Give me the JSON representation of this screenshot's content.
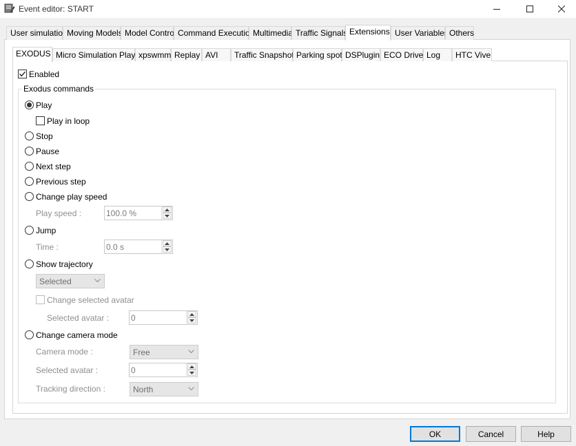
{
  "window": {
    "title": "Event editor: START",
    "app_icon": "editor-icon",
    "controls": [
      "minimize-icon",
      "maximize-icon",
      "close-icon"
    ]
  },
  "main_tabs": [
    {
      "label": "User simulation"
    },
    {
      "label": "Moving Models"
    },
    {
      "label": "Model Control"
    },
    {
      "label": "Command Execution"
    },
    {
      "label": "Multimedia"
    },
    {
      "label": "Traffic Signals"
    },
    {
      "label": "Extensions",
      "active": true
    },
    {
      "label": "User Variables"
    },
    {
      "label": "Others"
    }
  ],
  "sub_tabs": [
    {
      "label": "EXODUS",
      "active": true
    },
    {
      "label": "Micro Simulation Player"
    },
    {
      "label": "xpswmm"
    },
    {
      "label": "Replay"
    },
    {
      "label": "AVI"
    },
    {
      "label": "Traffic Snapshot"
    },
    {
      "label": "Parking spot"
    },
    {
      "label": "DSPlugin"
    },
    {
      "label": "ECO Drive"
    },
    {
      "label": "Log"
    },
    {
      "label": "HTC Vive"
    }
  ],
  "enabled": {
    "label": "Enabled",
    "checked": true
  },
  "group": {
    "title": "Exodus commands"
  },
  "commands": {
    "play": {
      "label": "Play",
      "selected": true
    },
    "play_in_loop": {
      "label": "Play in loop",
      "checked": false
    },
    "stop": {
      "label": "Stop"
    },
    "pause": {
      "label": "Pause"
    },
    "next_step": {
      "label": "Next step"
    },
    "previous_step": {
      "label": "Previous step"
    },
    "change_play_speed": {
      "label": "Change play speed"
    },
    "play_speed": {
      "label": "Play speed :",
      "value": "100.0 %"
    },
    "jump": {
      "label": "Jump"
    },
    "time": {
      "label": "Time :",
      "value": "0.0 s"
    },
    "show_trajectory": {
      "label": "Show trajectory"
    },
    "trajectory_select": {
      "value": "Selected"
    },
    "change_selected_avatar": {
      "label": "Change selected avatar",
      "checked": false
    },
    "selected_avatar_1": {
      "label": "Selected avatar :",
      "value": "0"
    },
    "change_camera_mode": {
      "label": "Change camera mode"
    },
    "camera_mode": {
      "label": "Camera mode :",
      "value": "Free"
    },
    "selected_avatar_2": {
      "label": "Selected avatar :",
      "value": "0"
    },
    "tracking_direction": {
      "label": "Tracking direction :",
      "value": "North"
    }
  },
  "buttons": {
    "ok": "OK",
    "cancel": "Cancel",
    "help": "Help"
  },
  "colors": {
    "default_button_border": "#0078d7",
    "window_bg": "#f0f0f0",
    "panel_bg": "#ffffff"
  }
}
